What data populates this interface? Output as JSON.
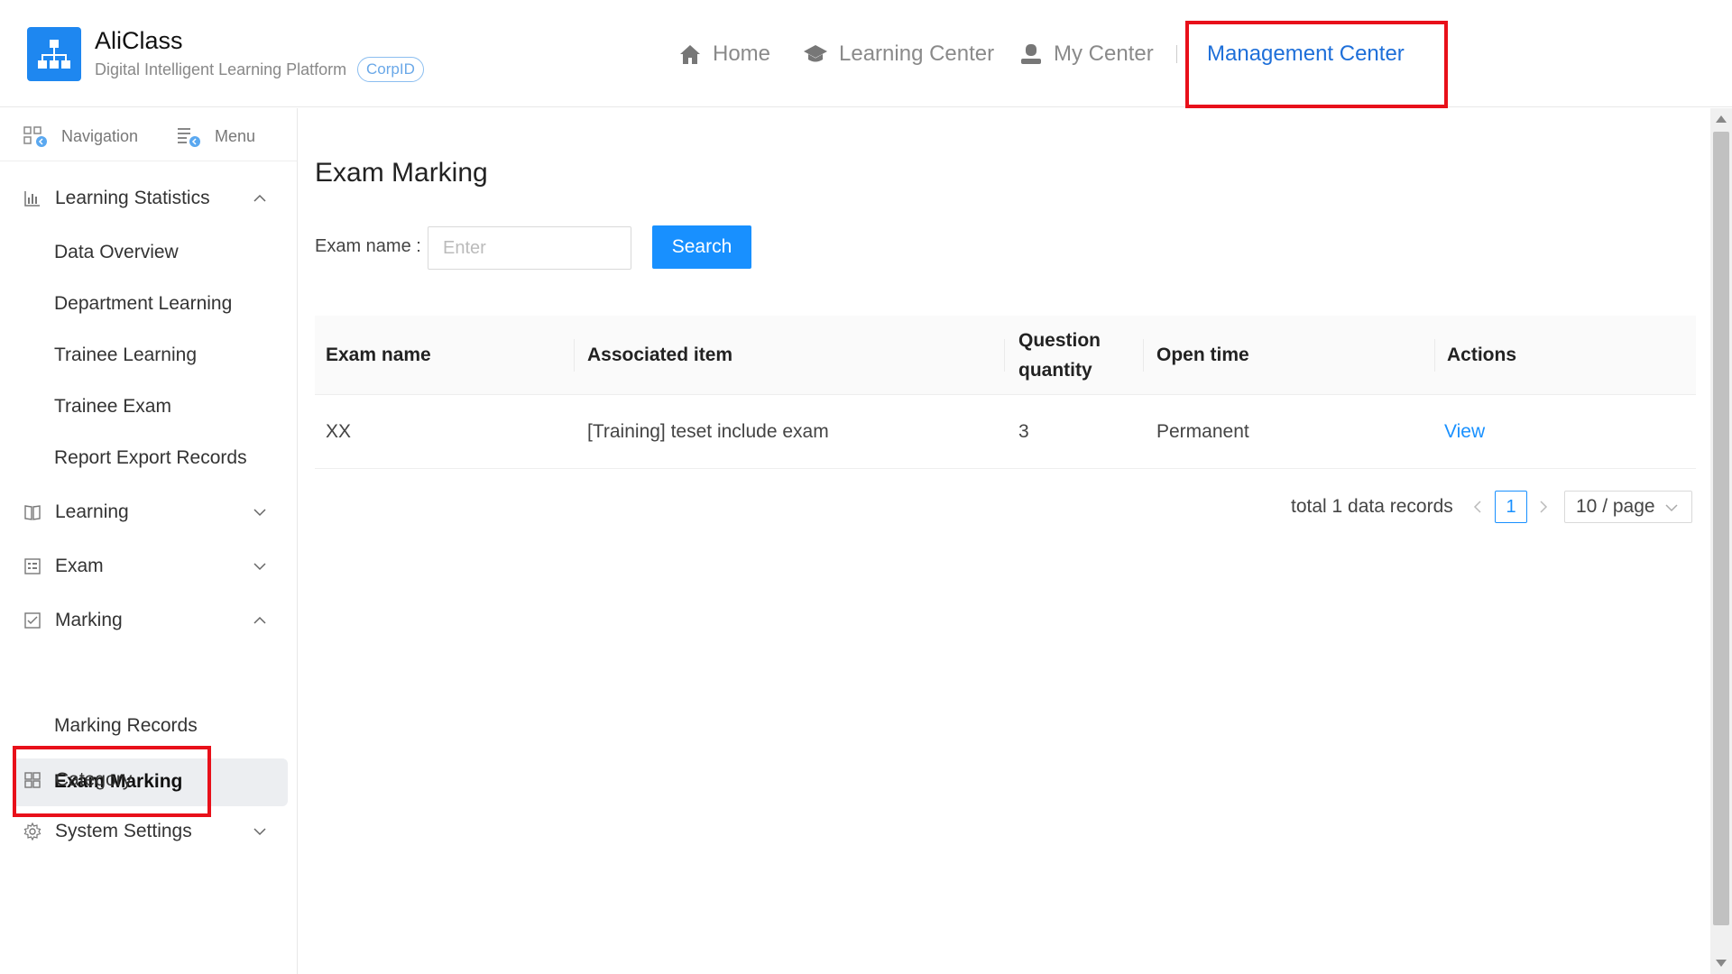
{
  "header": {
    "brand_name": "AliClass",
    "brand_sub": "Digital Intelligent Learning Platform",
    "corp_badge": "CorpID",
    "nav": {
      "home": "Home",
      "learning_center": "Learning Center",
      "my_center": "My Center",
      "management_center": "Management Center"
    }
  },
  "sidebar": {
    "navigation": "Navigation",
    "menu": "Menu",
    "learning_statistics": "Learning Statistics",
    "data_overview": "Data Overview",
    "department_learning": "Department Learning",
    "trainee_learning": "Trainee Learning",
    "trainee_exam": "Trainee Exam",
    "report_export_records": "Report Export Records",
    "learning": "Learning",
    "exam": "Exam",
    "marking": "Marking",
    "exam_marking": "Exam Marking",
    "marking_records": "Marking Records",
    "category": "Category",
    "system_settings": "System Settings"
  },
  "main": {
    "title": "Exam Marking",
    "filter_label": "Exam name",
    "filter_colon": ":",
    "filter_placeholder": "Enter",
    "search_button": "Search",
    "columns": {
      "exam_name": "Exam name",
      "associated_item": "Associated item",
      "question_quantity_1": "Question",
      "question_quantity_2": "quantity",
      "open_time": "Open time",
      "actions": "Actions"
    },
    "rows": [
      {
        "exam_name": "XX",
        "associated_item": "[Training] teset include exam",
        "question_quantity": "3",
        "open_time": "Permanent",
        "action": "View"
      }
    ],
    "pagination": {
      "total": "total 1 data records",
      "current_page": "1",
      "page_size": "10 / page"
    }
  },
  "colors": {
    "primary": "#1890ff",
    "highlight_box": "#e8101a",
    "logo_bg": "#1e87f0"
  }
}
